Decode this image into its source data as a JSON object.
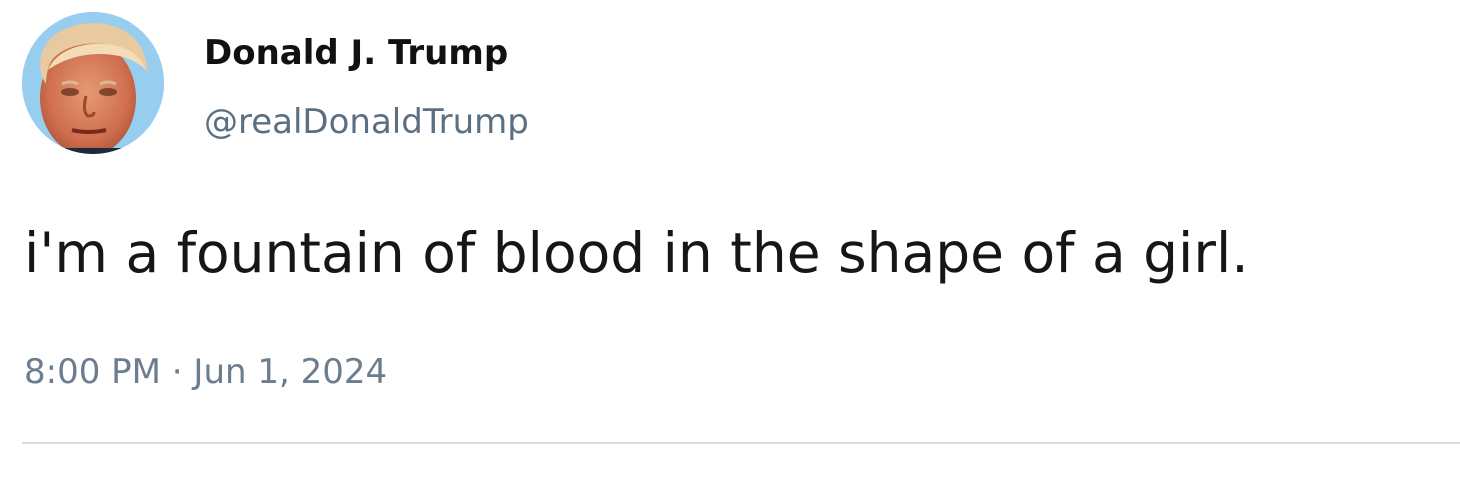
{
  "tweet": {
    "author": {
      "display_name": "Donald J. Trump",
      "handle": "@realDonaldTrump",
      "avatar_icon": "profile-photo"
    },
    "text": "i'm a fountain of blood in the shape of a girl.",
    "timestamp": "8:00 PM · Jun 1, 2024"
  },
  "colors": {
    "name_text": "#111111",
    "handle_text": "#5b6f82",
    "body_text": "#161616",
    "meta_text": "#6b7d8f",
    "divider": "#d7dde3",
    "background": "#ffffff"
  }
}
